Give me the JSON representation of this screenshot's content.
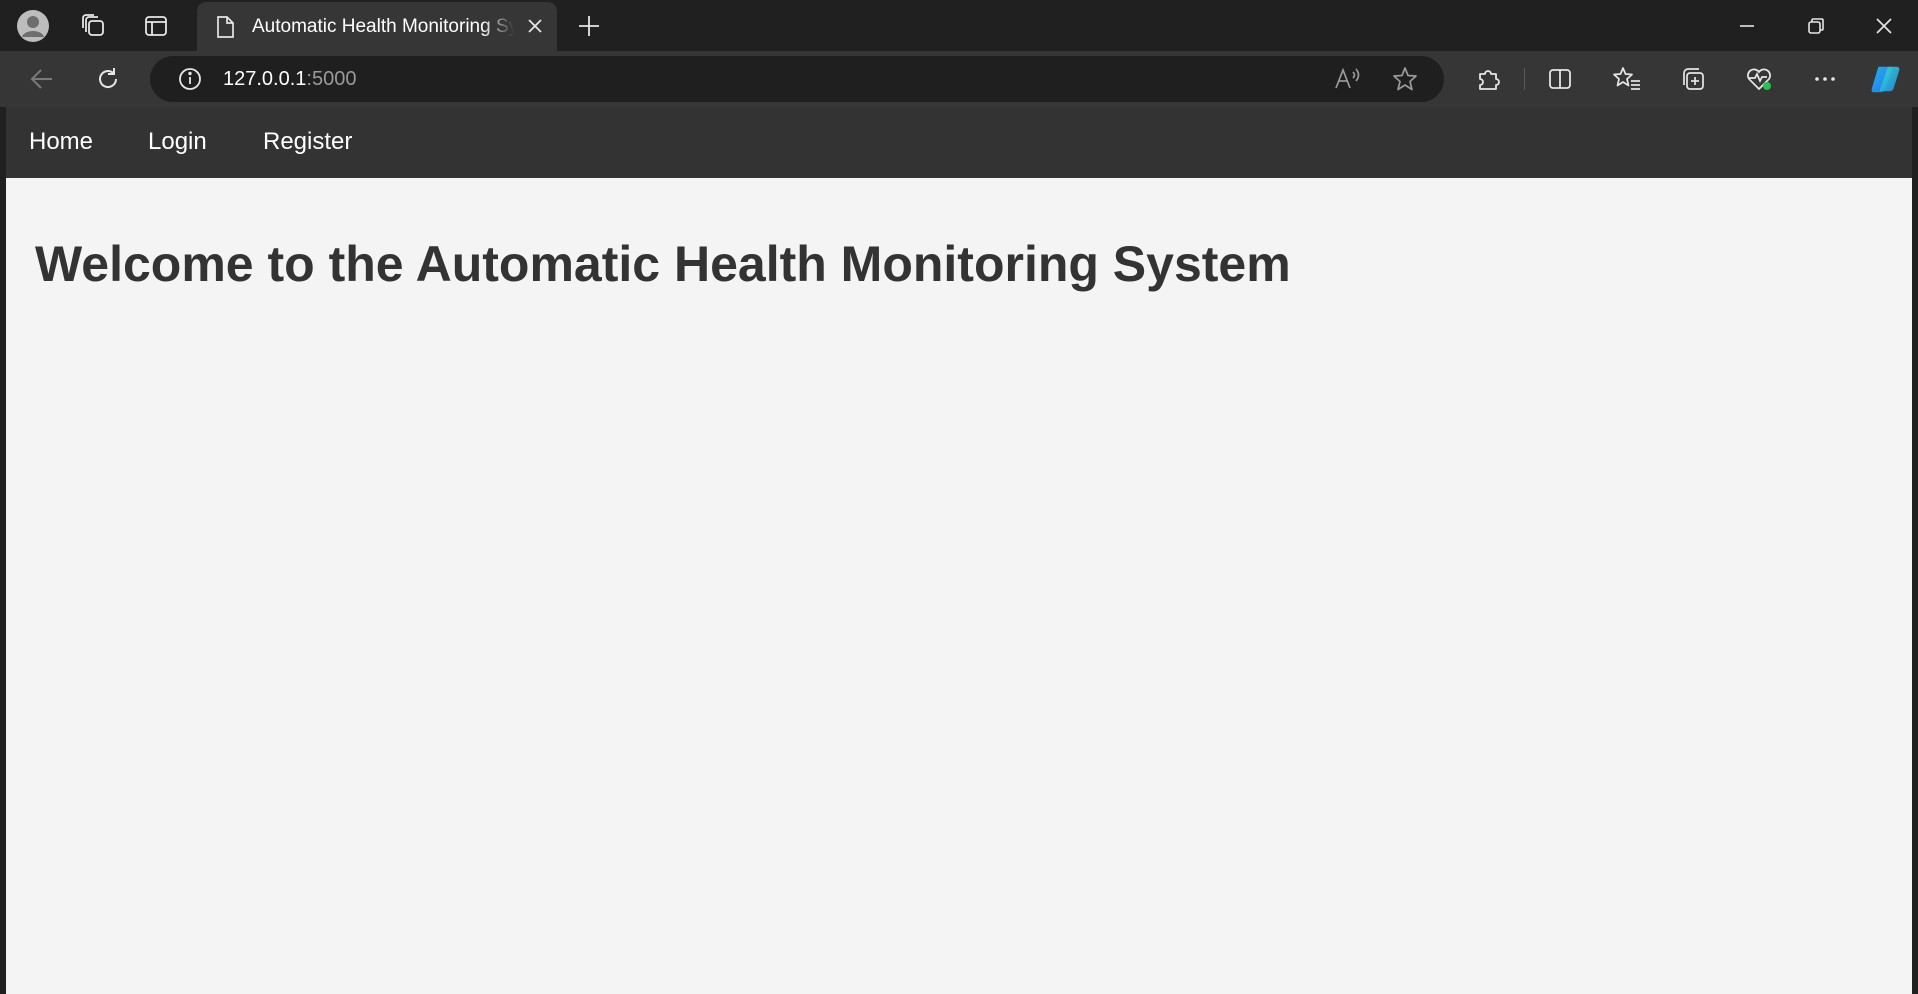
{
  "browser": {
    "tab": {
      "title": "Automatic Health Monitoring System",
      "icon": "page-icon"
    },
    "address": {
      "host": "127.0.0.1",
      "port": ":5000"
    },
    "icons": {
      "profile": "profile-avatar-icon",
      "workspaces": "workspaces-icon",
      "tab_actions": "vertical-tabs-icon",
      "new_tab": "plus-icon",
      "back": "back-arrow-icon",
      "refresh": "refresh-icon",
      "site_info": "info-icon",
      "read_aloud": "read-aloud-icon",
      "favorite": "star-icon",
      "extensions": "puzzle-icon",
      "split_screen": "split-screen-icon",
      "favorites": "favorites-list-icon",
      "collections": "collections-icon",
      "browser_essentials": "heart-pulse-icon",
      "more": "more-dots-icon",
      "copilot": "copilot-icon"
    },
    "colors": {
      "chrome": "#202020",
      "toolbar": "#363636",
      "accent_green": "#2dbf4e"
    }
  },
  "site": {
    "nav": [
      {
        "label": "Home"
      },
      {
        "label": "Login"
      },
      {
        "label": "Register"
      }
    ],
    "heading": "Welcome to the Automatic Health Monitoring System",
    "colors": {
      "nav_bg": "#333333",
      "page_bg": "#f4f4f4",
      "heading": "#333333"
    }
  }
}
